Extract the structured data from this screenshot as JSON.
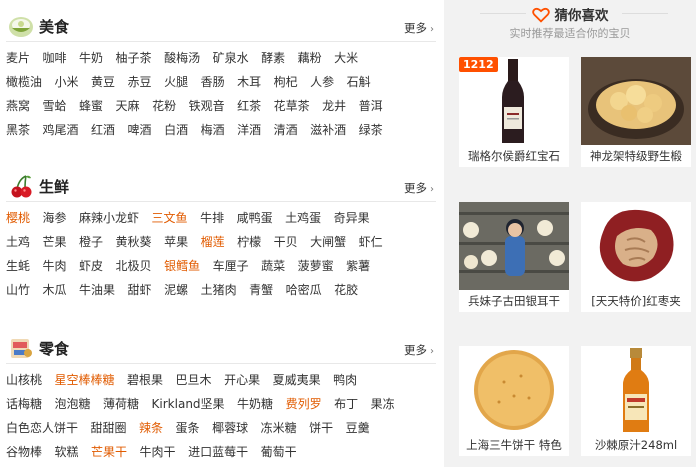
{
  "categories": [
    {
      "id": "food",
      "icon": "bowl-icon",
      "title": "美食",
      "more": "更多",
      "rows": [
        [
          {
            "t": "麦片"
          },
          {
            "t": "咖啡"
          },
          {
            "t": "牛奶"
          },
          {
            "t": "柚子茶"
          },
          {
            "t": "酸梅汤"
          },
          {
            "t": "矿泉水"
          },
          {
            "t": "酵素"
          },
          {
            "t": "藕粉"
          },
          {
            "t": "大米"
          }
        ],
        [
          {
            "t": "橄榄油"
          },
          {
            "t": "小米"
          },
          {
            "t": "黄豆"
          },
          {
            "t": "赤豆"
          },
          {
            "t": "火腿"
          },
          {
            "t": "香肠"
          },
          {
            "t": "木耳"
          },
          {
            "t": "枸杞"
          },
          {
            "t": "人参"
          },
          {
            "t": "石斛"
          }
        ],
        [
          {
            "t": "燕窝"
          },
          {
            "t": "雪蛤"
          },
          {
            "t": "蜂蜜"
          },
          {
            "t": "天麻"
          },
          {
            "t": "花粉"
          },
          {
            "t": "铁观音"
          },
          {
            "t": "红茶"
          },
          {
            "t": "花草茶"
          },
          {
            "t": "龙井"
          },
          {
            "t": "普洱"
          }
        ],
        [
          {
            "t": "黑茶"
          },
          {
            "t": "鸡尾酒"
          },
          {
            "t": "红酒"
          },
          {
            "t": "啤酒"
          },
          {
            "t": "白酒"
          },
          {
            "t": "梅酒"
          },
          {
            "t": "洋酒"
          },
          {
            "t": "清酒"
          },
          {
            "t": "滋补酒"
          },
          {
            "t": "绿茶"
          }
        ]
      ]
    },
    {
      "id": "fresh",
      "icon": "cherry-icon",
      "title": "生鲜",
      "more": "更多",
      "rows": [
        [
          {
            "t": "樱桃",
            "hot": true
          },
          {
            "t": "海参"
          },
          {
            "t": "麻辣小龙虾"
          },
          {
            "t": "三文鱼",
            "hot": true
          },
          {
            "t": "牛排"
          },
          {
            "t": "咸鸭蛋"
          },
          {
            "t": "土鸡蛋"
          },
          {
            "t": "奇异果"
          }
        ],
        [
          {
            "t": "土鸡"
          },
          {
            "t": "芒果"
          },
          {
            "t": "橙子"
          },
          {
            "t": "黄秋葵"
          },
          {
            "t": "苹果"
          },
          {
            "t": "榴莲",
            "hot": true
          },
          {
            "t": "柠檬"
          },
          {
            "t": "干贝"
          },
          {
            "t": "大闸蟹"
          },
          {
            "t": "虾仁"
          }
        ],
        [
          {
            "t": "生蚝"
          },
          {
            "t": "牛肉"
          },
          {
            "t": "虾皮"
          },
          {
            "t": "北极贝"
          },
          {
            "t": "银鳕鱼",
            "hot": true
          },
          {
            "t": "车厘子"
          },
          {
            "t": "蔬菜"
          },
          {
            "t": "菠萝蜜"
          },
          {
            "t": "紫薯"
          }
        ],
        [
          {
            "t": "山竹"
          },
          {
            "t": "木瓜"
          },
          {
            "t": "牛油果"
          },
          {
            "t": "甜虾"
          },
          {
            "t": "泥螺"
          },
          {
            "t": "土猪肉"
          },
          {
            "t": "青蟹"
          },
          {
            "t": "哈密瓜"
          },
          {
            "t": "花胶"
          }
        ]
      ]
    },
    {
      "id": "snack",
      "icon": "snack-icon",
      "title": "零食",
      "more": "更多",
      "rows": [
        [
          {
            "t": "山核桃"
          },
          {
            "t": "星空棒棒糖",
            "hot": true
          },
          {
            "t": "碧根果"
          },
          {
            "t": "巴旦木"
          },
          {
            "t": "开心果"
          },
          {
            "t": "夏威夷果"
          },
          {
            "t": "鸭肉"
          }
        ],
        [
          {
            "t": "话梅糖"
          },
          {
            "t": "泡泡糖"
          },
          {
            "t": "薄荷糖"
          },
          {
            "t": "Kirkland坚果"
          },
          {
            "t": "牛奶糖"
          },
          {
            "t": "费列罗",
            "hot": true
          },
          {
            "t": "布丁"
          },
          {
            "t": "果冻"
          }
        ],
        [
          {
            "t": "白色恋人饼干"
          },
          {
            "t": "甜甜圈"
          },
          {
            "t": "辣条",
            "hot": true
          },
          {
            "t": "蛋条"
          },
          {
            "t": "椰蓉球"
          },
          {
            "t": "冻米糖"
          },
          {
            "t": "饼干"
          },
          {
            "t": "豆羹"
          }
        ],
        [
          {
            "t": "谷物棒"
          },
          {
            "t": "软糕"
          },
          {
            "t": "芒果干",
            "hot": true
          },
          {
            "t": "牛肉干"
          },
          {
            "t": "进口蓝莓干"
          },
          {
            "t": "葡萄干"
          }
        ]
      ]
    }
  ],
  "guess": {
    "title": "猜你喜欢",
    "subtitle": "实时推荐最适合你的宝贝",
    "heart_color": "#ff5000",
    "items": [
      {
        "name": "瑞格尔侯爵红宝石",
        "badge": "1212",
        "icon": "wine-bottle-icon"
      },
      {
        "name": "神龙架特级野生椴",
        "icon": "honey-comb-icon"
      },
      {
        "name": "兵妹子古田银耳干",
        "icon": "tremella-photo-icon"
      },
      {
        "name": "[天天特价]红枣夹",
        "icon": "red-date-walnut-icon"
      },
      {
        "name": "上海三牛饼干 特色",
        "icon": "biscuit-icon"
      },
      {
        "name": "沙棘原汁248ml",
        "icon": "juice-bottle-icon"
      }
    ]
  }
}
